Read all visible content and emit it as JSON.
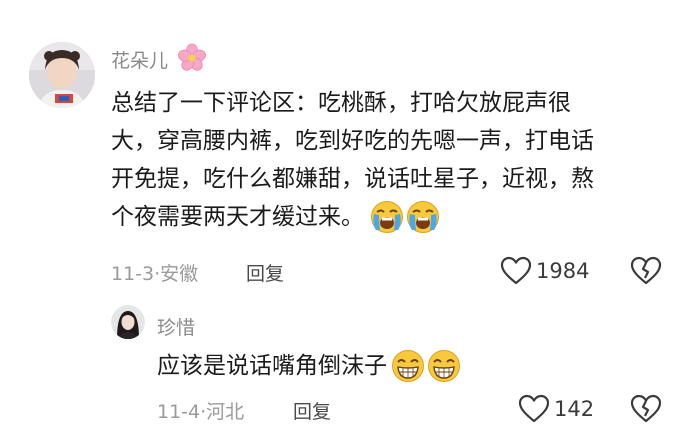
{
  "comment1": {
    "username": "花朵儿",
    "username_emoji": "cherry-blossom",
    "text_lines": [
      "总结了一下评论区：吃桃酥，打哈欠放屁声很",
      "大，穿高腰内裤，吃到好吃的先嗯一声，打电话",
      "开免提，吃什么都嫌甜，说话吐星子，近视，熬",
      "个夜需要两天才缓过来。"
    ],
    "text_emoji": "loudly-crying-face",
    "date": "11-3",
    "location": "安徽",
    "reply_label": "回复",
    "like_count": "1984"
  },
  "comment2": {
    "username": "珍惜",
    "text": "应该是说话嘴角倒沫子",
    "text_emoji": "grinning-face",
    "date": "11-4",
    "location": "河北",
    "reply_label": "回复",
    "like_count": "142"
  },
  "colors": {
    "username": "#8a8a8a",
    "body": "#1b1b1b",
    "meta": "#9a9a9a",
    "icon": "#3a3a3a"
  }
}
